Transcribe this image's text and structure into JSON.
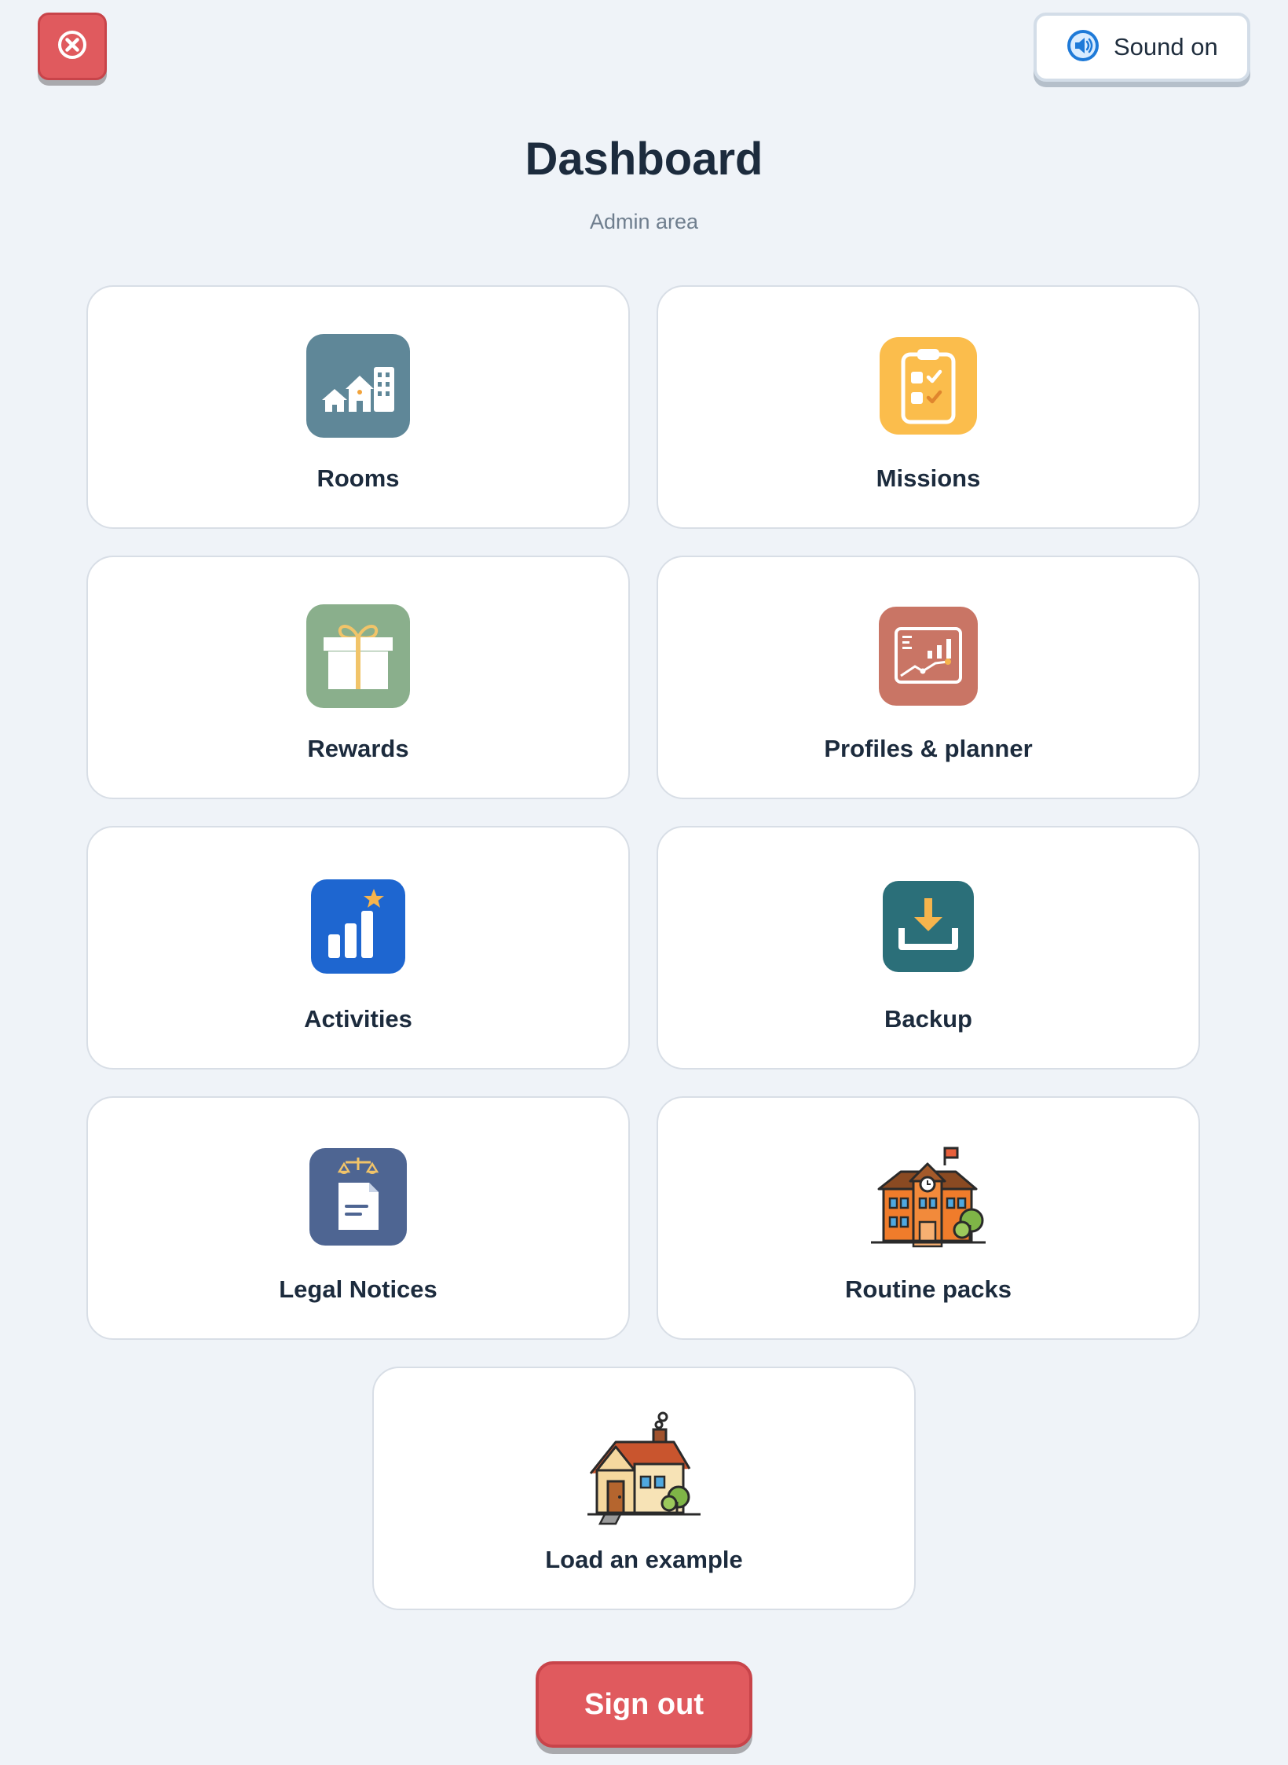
{
  "header": {
    "sound_label": "Sound on",
    "title": "Dashboard",
    "subtitle": "Admin area"
  },
  "cards": [
    {
      "label": "Rooms",
      "icon": "rooms-icon",
      "color": "#5f8798"
    },
    {
      "label": "Missions",
      "icon": "clipboard-checklist-icon",
      "color": "#fbbd4c"
    },
    {
      "label": "Rewards",
      "icon": "gift-icon",
      "color": "#8aaf8c"
    },
    {
      "label": "Profiles & planner",
      "icon": "analytics-board-icon",
      "color": "#c97565"
    },
    {
      "label": "Activities",
      "icon": "bar-chart-star-icon",
      "color": "#1e66d0"
    },
    {
      "label": "Backup",
      "icon": "download-tray-icon",
      "color": "#2b6f79"
    },
    {
      "label": "Legal Notices",
      "icon": "legal-document-icon",
      "color": "#4e6592"
    },
    {
      "label": "Routine packs",
      "icon": "school-building-icon",
      "color": "#f07c2b"
    },
    {
      "label": "Load an example",
      "icon": "house-icon",
      "color": "#f5d89e"
    }
  ],
  "footer": {
    "signout_label": "Sign out"
  },
  "colors": {
    "accent_red": "#e05a5e",
    "background": "#eff3f8",
    "text_dark": "#1c2b3d"
  }
}
